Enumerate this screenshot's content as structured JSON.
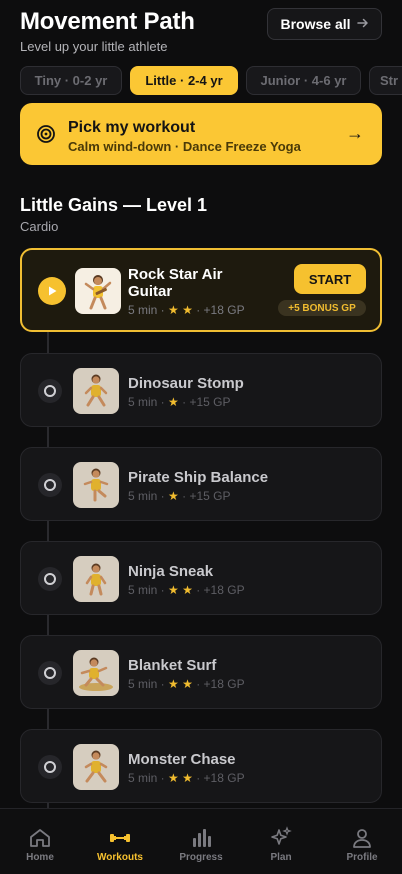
{
  "header": {
    "title": "Movement Path",
    "subtitle": "Level up your little athlete",
    "browse_label": "Browse all",
    "browse_icon": "arrow-right-icon"
  },
  "age_chips": [
    {
      "label": "Tiny · 0-2 yr",
      "active": false
    },
    {
      "label": "Little · 2-4 yr",
      "active": true
    },
    {
      "label": "Junior · 4-6 yr",
      "active": false
    },
    {
      "label": "Str",
      "active": false
    }
  ],
  "pick": {
    "title": "Pick my workout",
    "subtitle": "Calm wind-down · Dance Freeze Yoga",
    "icon": "target-icon",
    "arrow": "→"
  },
  "level": {
    "title": "Little Gains — Level 1",
    "category": "Cardio"
  },
  "workouts": [
    {
      "title": "Rock Star Air Guitar",
      "duration": "5 min",
      "stars": "★ ★",
      "gp": "+18 GP",
      "start_label": "START",
      "bonus_label": "+5 BONUS GP"
    },
    {
      "title": "Dinosaur Stomp",
      "duration": "5 min",
      "stars": "★",
      "gp": "+15 GP"
    },
    {
      "title": "Pirate Ship Balance",
      "duration": "5 min",
      "stars": "★",
      "gp": "+15 GP"
    },
    {
      "title": "Ninja Sneak",
      "duration": "5 min",
      "stars": "★ ★",
      "gp": "+18 GP"
    },
    {
      "title": "Blanket Surf",
      "duration": "5 min",
      "stars": "★ ★",
      "gp": "+18 GP"
    },
    {
      "title": "Monster Chase",
      "duration": "5 min",
      "stars": "★ ★",
      "gp": "+18 GP"
    }
  ],
  "tabs": [
    {
      "label": "Home",
      "icon": "home-icon",
      "active": false
    },
    {
      "label": "Workouts",
      "icon": "dumbbell-icon",
      "active": true
    },
    {
      "label": "Progress",
      "icon": "bar-chart-icon",
      "active": false
    },
    {
      "label": "Plan",
      "icon": "sparkles-icon",
      "active": false
    },
    {
      "label": "Profile",
      "icon": "person-icon",
      "active": false
    }
  ],
  "colors": {
    "accent": "#fbc734",
    "background": "#0d0d0e",
    "card": "#161618"
  }
}
